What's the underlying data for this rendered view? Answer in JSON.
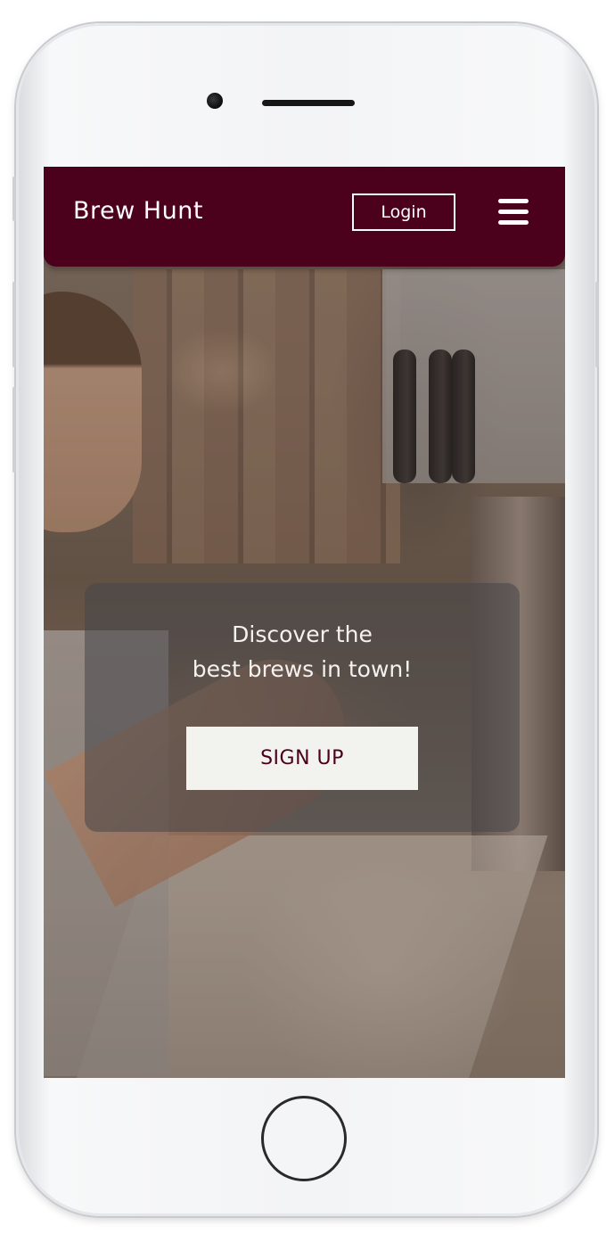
{
  "navbar": {
    "brand": "Brew Hunt",
    "login_label": "Login",
    "menu_icon": "hamburger-icon",
    "background_color": "#4b001c"
  },
  "hero": {
    "headline_line1": "Discover the",
    "headline_line2": "best brews in town!",
    "signup_label": "SIGN UP"
  },
  "device": {
    "type": "iPhone",
    "home_button_icon": "home-button-ring"
  }
}
